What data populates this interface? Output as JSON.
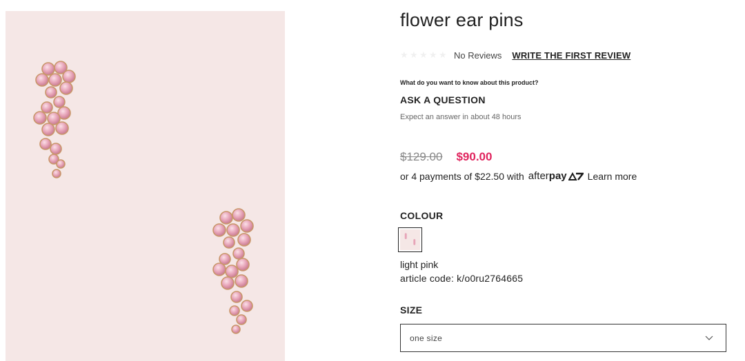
{
  "product": {
    "title": "flower ear pins",
    "image_icon": "earrings-photo"
  },
  "reviews": {
    "star_count": 5,
    "no_reviews_text": "No Reviews",
    "write_review_label": "WRITE THE FIRST REVIEW"
  },
  "questions": {
    "prompt": "What do you want to know about this product?",
    "ask_label": "ASK A QUESTION",
    "answer_time": "Expect an answer in about 48 hours"
  },
  "pricing": {
    "old_price": "$129.00",
    "new_price": "$90.00",
    "sale_color": "#e0245e",
    "installment_text": "or 4 payments of $22.50 with",
    "afterpay_thin": "after",
    "afterpay_bold": "pay",
    "learn_more": "Learn more"
  },
  "colour": {
    "label": "COLOUR",
    "selected_name": "light pink",
    "article_code": "article code: k/o0ru2764665",
    "swatch_color": "#f5e7e6"
  },
  "size": {
    "label": "SIZE",
    "selected": "one size",
    "icon": "chevron-down-icon"
  }
}
